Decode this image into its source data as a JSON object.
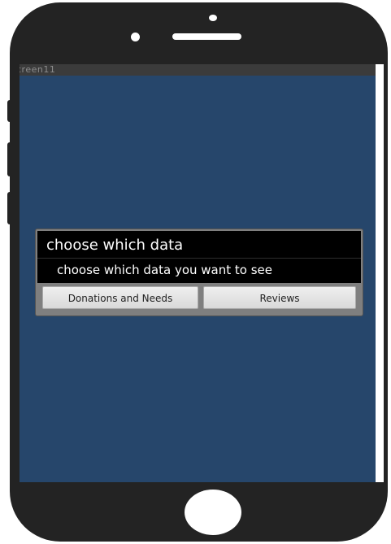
{
  "app": {
    "title_bar_text": "creen11"
  },
  "dialog": {
    "title": "choose which data",
    "message": "choose which data you want to see",
    "buttons": {
      "left_label": "Donations and Needs",
      "right_label": "Reviews"
    }
  },
  "colors": {
    "screen_background": "#26466b",
    "device_frame": "#232323"
  }
}
